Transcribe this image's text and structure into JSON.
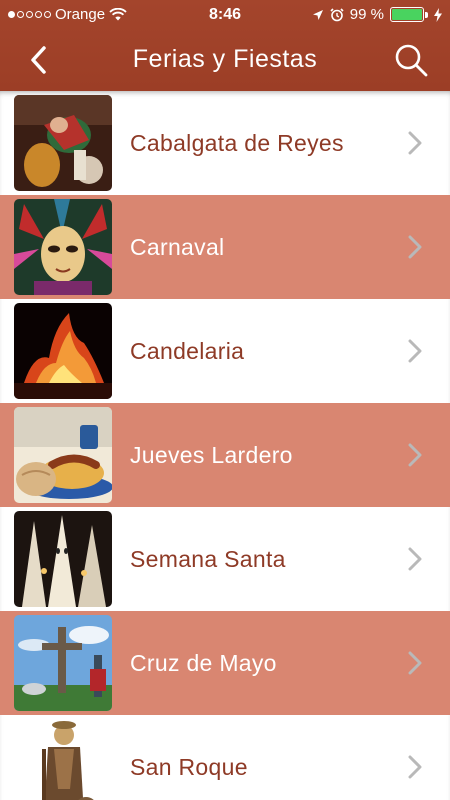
{
  "status_bar": {
    "carrier": "Orange",
    "time": "8:46",
    "battery_pct": "99 %",
    "battery_level": 0.99
  },
  "nav": {
    "title": "Ferias y Fiestas",
    "back_icon": "chevron-left-icon",
    "search_icon": "search-icon"
  },
  "colors": {
    "header": "#a0412a",
    "row_alt": "#d98671",
    "label_text": "#8e3a26",
    "chevron": "#b9b9b9"
  },
  "list": {
    "items": [
      {
        "label": "Cabalgata de Reyes",
        "thumb": "cabalgata-photo"
      },
      {
        "label": "Carnaval",
        "thumb": "carnaval-mask-photo"
      },
      {
        "label": "Candelaria",
        "thumb": "bonfire-photo"
      },
      {
        "label": "Jueves Lardero",
        "thumb": "bread-plate-photo"
      },
      {
        "label": "Semana Santa",
        "thumb": "procession-photo"
      },
      {
        "label": "Cruz de Mayo",
        "thumb": "cross-photo"
      },
      {
        "label": "San Roque",
        "thumb": "saint-statue-photo"
      }
    ]
  }
}
